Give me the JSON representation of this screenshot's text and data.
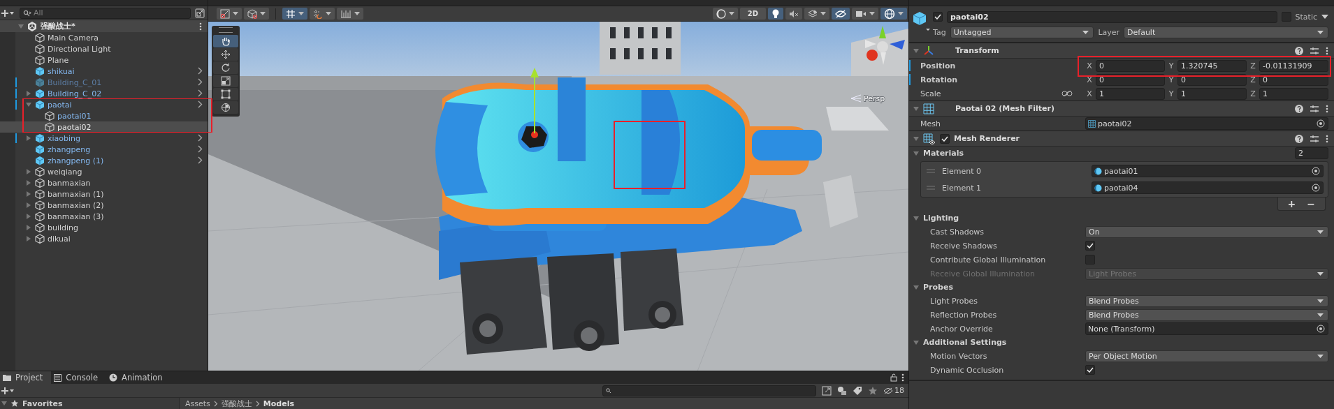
{
  "hierarchy": {
    "search": {
      "placeholder": "All"
    },
    "scene": {
      "name": "强酸战士*",
      "expanded": true
    },
    "items": [
      {
        "name": "Main Camera",
        "kind": "object",
        "selected": false,
        "active": true,
        "modified": false
      },
      {
        "name": "Directional Light",
        "kind": "object",
        "selected": false,
        "active": true,
        "modified": false
      },
      {
        "name": "Plane",
        "kind": "object",
        "selected": false,
        "active": true,
        "modified": false
      },
      {
        "name": "shikuai",
        "kind": "prefab",
        "selected": false,
        "active": true,
        "modified": false
      },
      {
        "name": "Building_C_01",
        "kind": "prefab",
        "selected": false,
        "active": false,
        "modified": true
      },
      {
        "name": "Building_C_02",
        "kind": "prefab",
        "expanded": false,
        "selected": false,
        "active": true,
        "modified": true
      },
      {
        "name": "paotai",
        "kind": "prefab",
        "expanded": true,
        "selected": false,
        "active": true,
        "modified": true,
        "children": [
          {
            "name": "paotai01",
            "kind": "prefab_child",
            "selected": false,
            "active": true,
            "modified": false
          },
          {
            "name": "paotai02",
            "kind": "object",
            "selected": true,
            "active": true,
            "modified": false
          }
        ]
      },
      {
        "name": "xiaobing",
        "kind": "prefab",
        "expanded": false,
        "selected": false,
        "active": true,
        "modified": true
      },
      {
        "name": "zhangpeng",
        "kind": "prefab",
        "selected": false,
        "active": true,
        "modified": false
      },
      {
        "name": "zhangpeng (1)",
        "kind": "prefab",
        "selected": false,
        "active": true,
        "modified": false
      },
      {
        "name": "weiqiang",
        "kind": "object",
        "expanded": false,
        "selected": false,
        "active": true,
        "modified": false
      },
      {
        "name": "banmaxian",
        "kind": "object",
        "expanded": false,
        "selected": false,
        "active": true,
        "modified": false
      },
      {
        "name": "banmaxian (1)",
        "kind": "object",
        "expanded": false,
        "selected": false,
        "active": true,
        "modified": false
      },
      {
        "name": "banmaxian (2)",
        "kind": "object",
        "expanded": false,
        "selected": false,
        "active": true,
        "modified": false
      },
      {
        "name": "banmaxian (3)",
        "kind": "object",
        "expanded": false,
        "selected": false,
        "active": true,
        "modified": false
      },
      {
        "name": "building",
        "kind": "object",
        "expanded": false,
        "selected": false,
        "active": true,
        "modified": false
      },
      {
        "name": "dikuai",
        "kind": "object",
        "expanded": false,
        "selected": false,
        "active": true,
        "modified": false
      }
    ]
  },
  "scene_toolbar": {
    "left": [
      {
        "kind": "draw-mode",
        "selected": false,
        "dropdown": true
      },
      {
        "kind": "cube",
        "selected": false,
        "dropdown": true
      },
      {
        "kind": "grid",
        "selected": true,
        "dropdown": true
      },
      {
        "kind": "snap",
        "selected": false,
        "dropdown": true
      },
      {
        "kind": "ruler",
        "selected": false,
        "dropdown": true
      }
    ],
    "right": [
      {
        "kind": "shading",
        "selected": false,
        "dropdown": true
      },
      {
        "kind": "text",
        "label": "2D",
        "selected": false,
        "dropdown": false
      },
      {
        "kind": "light",
        "selected": true,
        "dropdown": false
      },
      {
        "kind": "audio",
        "selected": false,
        "dropdown": false
      },
      {
        "kind": "effects",
        "selected": false,
        "dropdown": true
      },
      {
        "kind": "hidden",
        "selected": true,
        "dropdown": false
      },
      {
        "kind": "camera",
        "selected": false,
        "dropdown": true
      },
      {
        "kind": "gizmos",
        "selected": true,
        "dropdown": true
      }
    ]
  },
  "tool_palette": [
    {
      "kind": "hand",
      "selected": true
    },
    {
      "kind": "move",
      "selected": false
    },
    {
      "kind": "rotate",
      "selected": false
    },
    {
      "kind": "scale",
      "selected": false
    },
    {
      "kind": "rect",
      "selected": false
    },
    {
      "kind": "transform",
      "selected": false
    }
  ],
  "scene_view": {
    "projection": "Persp"
  },
  "inspector": {
    "object": {
      "name": "paotai02",
      "active": true,
      "static": false,
      "static_label": "Static",
      "tag_label": "Tag",
      "tag": "Untagged",
      "layer_label": "Layer",
      "layer": "Default"
    },
    "transform": {
      "title": "Transform",
      "expanded": true,
      "rows": [
        {
          "label": "Position",
          "overridden": true,
          "values": [
            {
              "axis": "X",
              "value": "0"
            },
            {
              "axis": "Y",
              "value": "1.320745"
            },
            {
              "axis": "Z",
              "value": "-0.01131909"
            }
          ]
        },
        {
          "label": "Rotation",
          "overridden": true,
          "values": [
            {
              "axis": "X",
              "value": "0"
            },
            {
              "axis": "Y",
              "value": "0"
            },
            {
              "axis": "Z",
              "value": "0"
            }
          ]
        },
        {
          "label": "Scale",
          "overridden": false,
          "values": [
            {
              "axis": "X",
              "value": "1"
            },
            {
              "axis": "Y",
              "value": "1"
            },
            {
              "axis": "Z",
              "value": "1"
            }
          ]
        }
      ]
    },
    "mesh_filter": {
      "title": "Paotai 02 (Mesh Filter)",
      "expanded": true,
      "label": "Mesh",
      "value": "paotai02"
    },
    "mesh_renderer": {
      "title": "Mesh Renderer",
      "expanded": true,
      "enabled": true,
      "materials": {
        "label": "Materials",
        "expanded": true,
        "count": "2",
        "elements": [
          {
            "label": "Element 0",
            "value": "paotai01"
          },
          {
            "label": "Element 1",
            "value": "paotai04"
          }
        ],
        "add": "+",
        "remove": "−"
      },
      "sections": [
        {
          "title": "Lighting",
          "expanded": true,
          "rows": [
            {
              "label": "Cast Shadows",
              "kind": "dropdown",
              "value": "On",
              "disabled": false
            },
            {
              "label": "Receive Shadows",
              "kind": "checkbox",
              "checked": true,
              "disabled": false
            },
            {
              "label": "Contribute Global Illumination",
              "kind": "checkbox",
              "checked": false,
              "disabled": false
            },
            {
              "label": "Receive Global Illumination",
              "kind": "dropdown",
              "value": "Light Probes",
              "disabled": true
            }
          ]
        },
        {
          "title": "Probes",
          "expanded": true,
          "rows": [
            {
              "label": "Light Probes",
              "kind": "dropdown",
              "value": "Blend Probes",
              "disabled": false
            },
            {
              "label": "Reflection Probes",
              "kind": "dropdown",
              "value": "Blend Probes",
              "disabled": false
            },
            {
              "label": "Anchor Override",
              "kind": "object",
              "value": "None (Transform)",
              "disabled": false
            }
          ]
        },
        {
          "title": "Additional Settings",
          "expanded": true,
          "rows": [
            {
              "label": "Motion Vectors",
              "kind": "dropdown",
              "value": "Per Object Motion",
              "disabled": false
            },
            {
              "label": "Dynamic Occlusion",
              "kind": "checkbox",
              "checked": true,
              "disabled": false
            }
          ]
        }
      ]
    }
  },
  "bottom": {
    "tabs": [
      {
        "label": "Project",
        "kind": "folder",
        "selected": true
      },
      {
        "label": "Console",
        "kind": "console",
        "selected": false
      },
      {
        "label": "Animation",
        "kind": "clock",
        "selected": false
      }
    ],
    "hidden_count": "18",
    "favorites": "Favorites",
    "breadcrumb": [
      "Assets",
      "强酸战士",
      "Models"
    ]
  }
}
